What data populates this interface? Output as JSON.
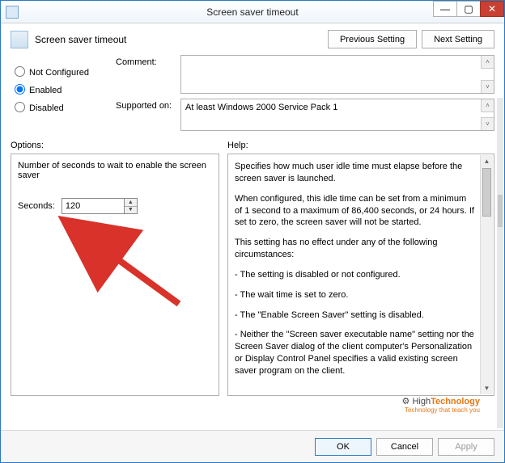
{
  "window": {
    "title": "Screen saver timeout"
  },
  "header": {
    "policy_name": "Screen saver timeout",
    "prev_btn": "Previous Setting",
    "next_btn": "Next Setting"
  },
  "state": {
    "not_configured": "Not Configured",
    "enabled": "Enabled",
    "disabled": "Disabled",
    "selected": "enabled"
  },
  "fields": {
    "comment_label": "Comment:",
    "comment_value": "",
    "supported_label": "Supported on:",
    "supported_value": "At least Windows 2000 Service Pack 1"
  },
  "sections": {
    "options": "Options:",
    "help": "Help:"
  },
  "options": {
    "description": "Number of seconds to wait to enable the screen saver",
    "seconds_label": "Seconds:",
    "seconds_value": "120"
  },
  "help": {
    "p1": "Specifies how much user idle time must elapse before the screen saver is launched.",
    "p2": "When configured, this idle time can be set from a minimum of 1 second to a maximum of 86,400 seconds, or 24 hours. If set to zero, the screen saver will not be started.",
    "p3": "This setting has no effect under any of the following circumstances:",
    "b1": "   - The setting is disabled or not configured.",
    "b2": "   - The wait time is set to zero.",
    "b3": "   - The \"Enable Screen Saver\" setting is disabled.",
    "b4": "   - Neither the \"Screen saver executable name\" setting nor the Screen Saver dialog of the client computer's Personalization or Display Control Panel specifies a valid existing screen saver program on the client."
  },
  "footer": {
    "ok": "OK",
    "cancel": "Cancel",
    "apply": "Apply"
  },
  "watermark": {
    "brand_a": "High",
    "brand_b": "Technology",
    "tagline": "Technology that teach you"
  }
}
